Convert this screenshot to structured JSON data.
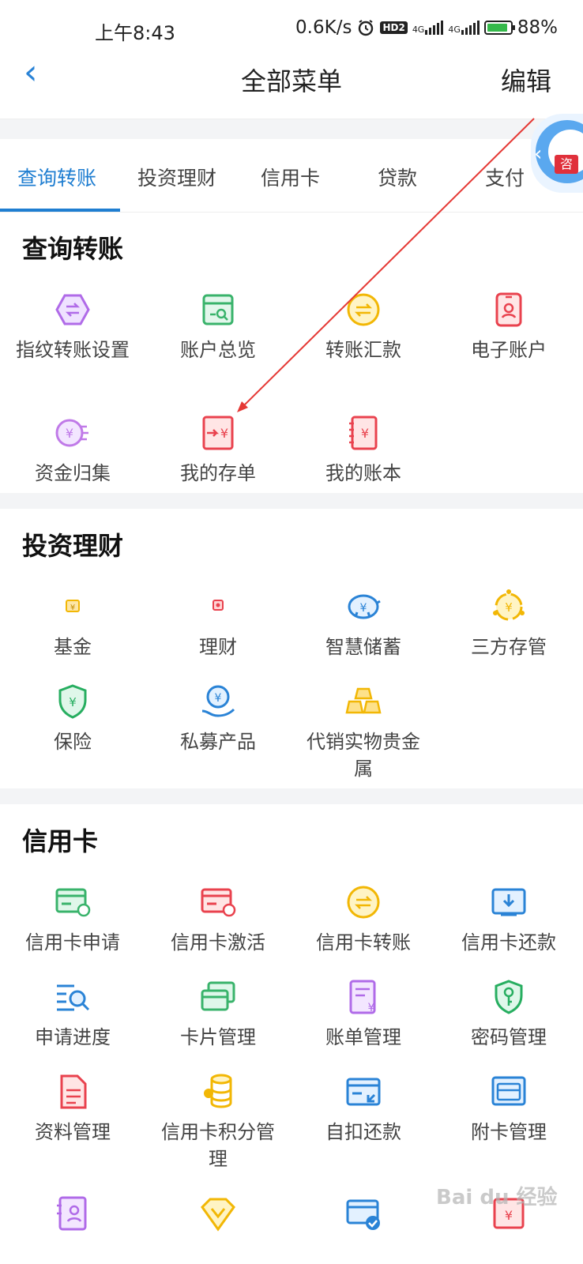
{
  "status_bar": {
    "time": "上午8:43",
    "speed": "0.6K/s",
    "hd": "HD2",
    "net1": "4G",
    "net2": "4G",
    "battery": "88%"
  },
  "header": {
    "title": "全部菜单",
    "edit": "编辑"
  },
  "tabs": [
    "查询转账",
    "投资理财",
    "信用卡",
    "贷款",
    "支付"
  ],
  "assistant_tag": "咨",
  "sections": [
    {
      "title": "查询转账",
      "items": [
        "指纹转账设置",
        "账户总览",
        "转账汇款",
        "电子账户",
        "资金归集",
        "我的存单",
        "我的账本"
      ]
    },
    {
      "title": "投资理财",
      "items": [
        "基金",
        "理财",
        "智慧储蓄",
        "三方存管",
        "保险",
        "私募产品",
        "代销实物贵金属"
      ]
    },
    {
      "title": "信用卡",
      "items": [
        "信用卡申请",
        "信用卡激活",
        "信用卡转账",
        "信用卡还款",
        "申请进度",
        "卡片管理",
        "账单管理",
        "密码管理",
        "资料管理",
        "信用卡积分管理",
        "自扣还款",
        "附卡管理"
      ]
    }
  ],
  "watermark": "Bai du 经验",
  "colors": {
    "accent": "#1f7ed1",
    "annotation_arrow": "#e53935"
  }
}
